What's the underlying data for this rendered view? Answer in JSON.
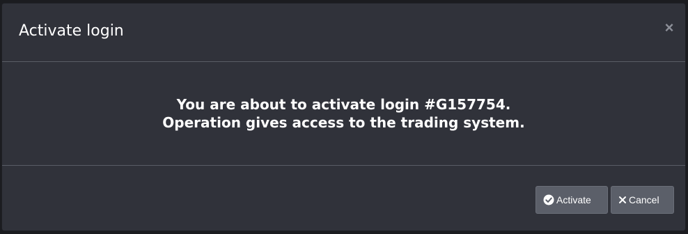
{
  "dialog": {
    "title": "Activate login",
    "close_symbol": "×",
    "message_line1": "You are about to activate login #G157754.",
    "message_line2": "Operation gives access to the trading system."
  },
  "footer": {
    "activate_label": "Activate",
    "cancel_label": "Cancel"
  },
  "icons": {
    "activate": "check-circle-icon",
    "cancel": "x-icon",
    "close": "close-icon"
  },
  "colors": {
    "dialog_bg": "#30323a",
    "button_bg": "#5b5f69",
    "text": "#ffffff",
    "divider": "#5a5d66"
  }
}
